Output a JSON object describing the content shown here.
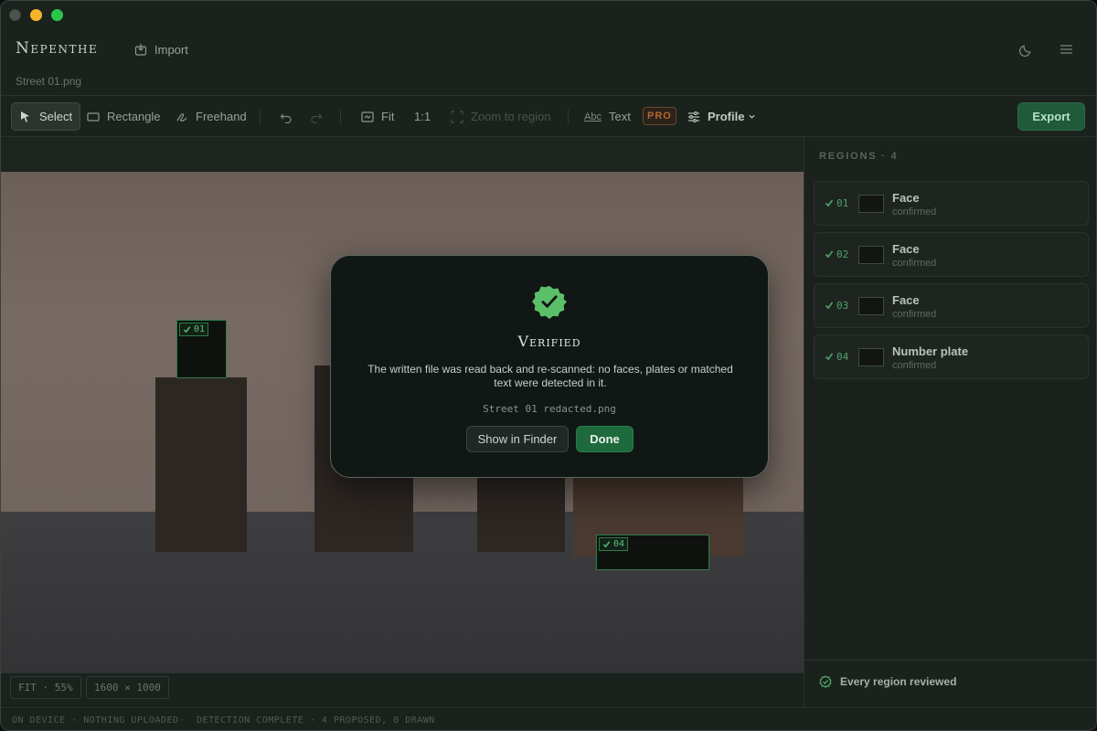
{
  "app": {
    "title": "Nepenthe",
    "import_label": "Import",
    "filename": "Street 01.png"
  },
  "toolbar": {
    "select": "Select",
    "rectangle": "Rectangle",
    "freehand": "Freehand",
    "fit": "Fit",
    "one_to_one": "1:1",
    "zoom_to_region": "Zoom to region",
    "text_icon": "Abc",
    "text": "Text",
    "pro_badge": "PRO",
    "profile": "Profile",
    "export": "Export"
  },
  "canvas": {
    "region_tags": [
      {
        "id": "01"
      },
      {
        "id": "04"
      }
    ],
    "zoom_chip": "FIT · 55%",
    "size_chip": "1600 × 1000"
  },
  "sidebar": {
    "title": "REGIONS · 4",
    "regions": [
      {
        "num": "01",
        "label": "Face",
        "status": "confirmed"
      },
      {
        "num": "02",
        "label": "Face",
        "status": "confirmed"
      },
      {
        "num": "03",
        "label": "Face",
        "status": "confirmed"
      },
      {
        "num": "04",
        "label": "Number plate",
        "status": "confirmed"
      }
    ],
    "review_status": "Every region reviewed"
  },
  "status_bar": {
    "left": "ON DEVICE · NOTHING UPLOADED",
    "sep": "·",
    "right": "DETECTION COMPLETE · 4 PROPOSED, 0 DRAWN"
  },
  "dialog": {
    "title": "Verified",
    "body": "The written file was read back and re-scanned: no faces, plates or matched text were detected in it.",
    "file": "Street 01 redacted.png",
    "show_in_finder": "Show in Finder",
    "done": "Done"
  },
  "colors": {
    "accent": "#1f6a3d",
    "badge_green": "#5bbf6a",
    "pro": "#b4692f"
  }
}
